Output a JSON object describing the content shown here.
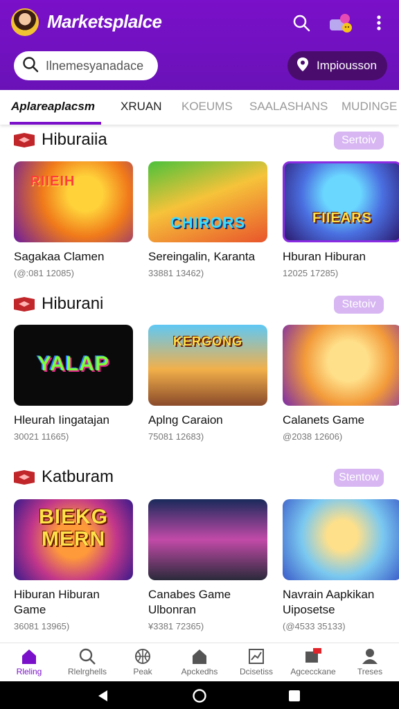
{
  "header": {
    "title": "Marketsplalce",
    "search_placeholder": "Ilnemesyanadace",
    "promo_label": "Impiousson"
  },
  "tabs": [
    {
      "label": "Aplareaplacsm",
      "active": true
    },
    {
      "label": "XRUAN",
      "active": false
    },
    {
      "label": "KOEUMS",
      "active": false
    },
    {
      "label": "SAALASHANS",
      "active": false
    },
    {
      "label": "MUDINGE",
      "active": false
    }
  ],
  "sections": [
    {
      "title": "Hiburaiia",
      "see_all": "Sertoiv",
      "cards": [
        {
          "title": "Sagakaa Clamen",
          "meta": "(@:081 12085)",
          "art": "RIIEIH"
        },
        {
          "title": "Sereingalin, Karanta",
          "meta": "33881 13462)",
          "art": "CHIRORS"
        },
        {
          "title": "Hburan Hiburan",
          "meta": "12025 17285)",
          "art": "FIIEARS"
        }
      ]
    },
    {
      "title": "Hiburani",
      "see_all": "Stetoiv",
      "cards": [
        {
          "title": "Hleurah Iingatajan",
          "meta": "30021 11665)",
          "art": "YALAP"
        },
        {
          "title": "Aplng Caraion",
          "meta": "75081 12683)",
          "art": "KERGONG"
        },
        {
          "title": "Calanets Game",
          "meta": "@2038 12606)",
          "art": ""
        }
      ]
    },
    {
      "title": "Katburam",
      "see_all": "Stentow",
      "cards": [
        {
          "title": "Hiburan Hiburan Game",
          "meta": "36081 13965)",
          "art": "BIEKG MERN"
        },
        {
          "title": "Canabes Game Ulbonran",
          "meta": "¥3381 72365)",
          "art": ""
        },
        {
          "title": "Navrain Aapkikan Uiposetse",
          "meta": "(@4533 35133)",
          "art": ""
        }
      ]
    }
  ],
  "bottom_nav": [
    {
      "label": "Rleling",
      "icon": "home-icon",
      "active": true
    },
    {
      "label": "Rlelrghells",
      "icon": "search-icon",
      "active": false
    },
    {
      "label": "Peak",
      "icon": "basketball-icon",
      "active": false
    },
    {
      "label": "Apckedhs",
      "icon": "house-icon",
      "active": false
    },
    {
      "label": "Dcisetiss",
      "icon": "chart-icon",
      "active": false
    },
    {
      "label": "Agcecckane",
      "icon": "store-icon",
      "active": false
    },
    {
      "label": "Treses",
      "icon": "person-icon",
      "active": false
    }
  ],
  "colors": {
    "brand": "#7a10c9",
    "promo_bg": "#4a0d6e",
    "see_all_bg": "#d7b6f2"
  }
}
